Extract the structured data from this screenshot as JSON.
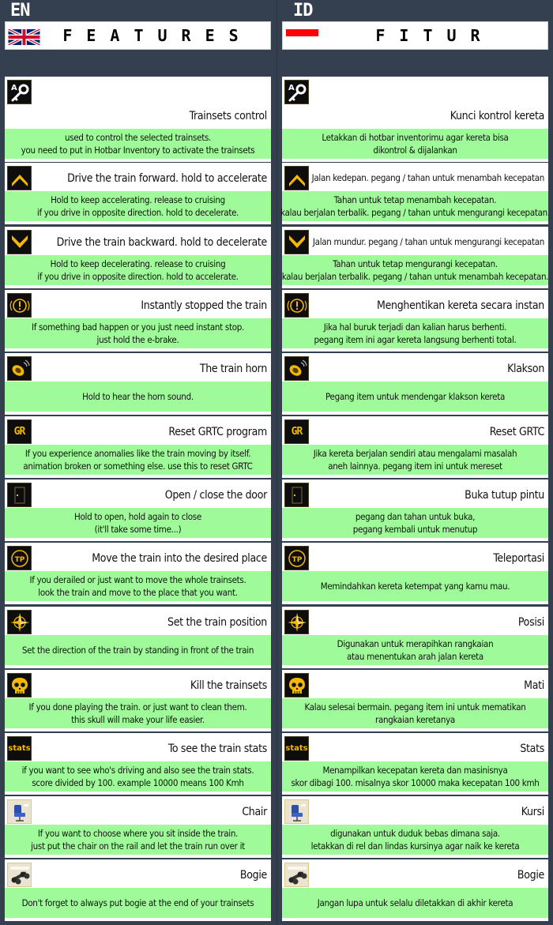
{
  "columns": [
    {
      "lang": "EN",
      "header_title": "FEATURES",
      "flag": "uk-flag",
      "items": [
        {
          "icon": "key-icon",
          "title": "Trainsets control",
          "desc": [
            "used to control the selected trainsets.",
            "you need to put in Hotbar Inventory to activate the trainsets"
          ]
        },
        {
          "icon": "chevron-up-icon",
          "title": "Drive the train forward. hold to accelerate",
          "desc": [
            "Hold to keep accelerating. release to cruising",
            "if you drive in opposite direction. hold to decelerate."
          ]
        },
        {
          "icon": "chevron-down-icon",
          "title": "Drive the train backward. hold to decelerate",
          "desc": [
            "Hold to keep decelerating. release to cruising",
            "if you drive in opposite direction. hold to accelerate."
          ]
        },
        {
          "icon": "emergency-brake-icon",
          "title": "Instantly stopped the train",
          "desc": [
            "If something bad happen or you just need instant stop.",
            "just hold the e-brake."
          ]
        },
        {
          "icon": "horn-icon",
          "title": "The train horn",
          "desc": [
            "Hold to hear the horn sound."
          ]
        },
        {
          "icon": "grtc-reset-icon",
          "title": "Reset GRTC program",
          "desc": [
            "If you experience anomalies like the train moving by itself.",
            "animation broken or something else. use this to reset GRTC"
          ]
        },
        {
          "icon": "door-icon",
          "title": "Open / close the door",
          "desc": [
            "Hold to open, hold again to close",
            "(it'll take some time...)"
          ]
        },
        {
          "icon": "teleport-icon",
          "title": "Move the train into the desired place",
          "desc": [
            "If you derailed or just want to move the whole trainsets.",
            "look the train and move to the place that you want."
          ]
        },
        {
          "icon": "compass-icon",
          "title": "Set the train position",
          "desc": [
            "Set the direction of the train by standing in front of the train"
          ]
        },
        {
          "icon": "skull-icon",
          "title": "Kill the trainsets",
          "desc": [
            "If you done playing the train. or just want to clean them.",
            "this skull will make your life easier."
          ]
        },
        {
          "icon": "stats-icon",
          "title": "To see the train stats",
          "desc": [
            "if you want to see who's driving and also see the train stats.",
            "score divided by 100. example 10000 means 100 Kmh"
          ]
        },
        {
          "icon": "chair-icon",
          "title": "Chair",
          "desc": [
            "If you want to choose where you sit inside the train.",
            "just put the chair on the rail and let the train run over it"
          ]
        },
        {
          "icon": "bogie-icon",
          "title": "Bogie",
          "desc": [
            "Don't forget to always put bogie at the end of your trainsets"
          ]
        }
      ]
    },
    {
      "lang": "ID",
      "header_title": "FITUR",
      "flag": "indonesia-flag",
      "items": [
        {
          "icon": "key-icon",
          "title": "Kunci kontrol kereta",
          "desc": [
            "Letakkan di hotbar inventorimu agar kereta bisa",
            "dikontrol & dijalankan"
          ]
        },
        {
          "icon": "chevron-up-icon",
          "title": "Jalan kedepan. pegang / tahan untuk menambah kecepatan",
          "desc": [
            "Tahan untuk tetap menambah kecepatan.",
            "kalau berjalan terbalik. pegang / tahan untuk mengurangi kecepatan."
          ]
        },
        {
          "icon": "chevron-down-icon",
          "title": "Jalan mundur. pegang / tahan untuk mengurangi kecepatan",
          "desc": [
            "Tahan untuk tetap mengurangi kecepatan.",
            "kalau berjalan terbalik. pegang / tahan untuk menambah kecepatan."
          ]
        },
        {
          "icon": "emergency-brake-icon",
          "title": "Menghentikan kereta secara instan",
          "desc": [
            "Jika hal buruk terjadi dan kalian harus berhenti.",
            "pegang item ini agar kereta langsung berhenti total."
          ]
        },
        {
          "icon": "horn-icon",
          "title": "Klakson",
          "desc": [
            "Pegang item untuk mendengar klakson kereta"
          ]
        },
        {
          "icon": "grtc-reset-icon",
          "title": "Reset GRTC",
          "desc": [
            "Jika kereta berjalan sendiri atau mengalami masalah",
            "aneh lainnya. pegang item ini untuk mereset"
          ]
        },
        {
          "icon": "door-icon",
          "title": "Buka tutup pintu",
          "desc": [
            "pegang dan tahan untuk buka,",
            "pegang kembali untuk menutup"
          ]
        },
        {
          "icon": "teleport-icon",
          "title": "Teleportasi",
          "desc": [
            "Memindahkan kereta ketempat yang kamu mau."
          ]
        },
        {
          "icon": "compass-icon",
          "title": "Posisi",
          "desc": [
            "Digunakan untuk merapihkan rangkaian",
            "atau menentukan arah jalan kereta"
          ]
        },
        {
          "icon": "skull-icon",
          "title": "Mati",
          "desc": [
            "Kalau selesai bermain. pegang item ini untuk mematikan",
            "rangkaian keretanya"
          ]
        },
        {
          "icon": "stats-icon",
          "title": "Stats",
          "desc": [
            "Menampilkan kecepatan kereta dan masinisnya",
            "skor dibagi 100. misalnya skor 10000 maka kecepatan 100 kmh"
          ]
        },
        {
          "icon": "chair-icon",
          "title": "Kursi",
          "desc": [
            "digunakan untuk duduk bebas dimana saja.",
            "letakkan di rel dan lindas kursinya agar naik ke kereta"
          ]
        },
        {
          "icon": "bogie-icon",
          "title": "Bogie",
          "desc": [
            "Jangan lupa untuk selalu diletakkan di akhir kereta"
          ]
        }
      ]
    }
  ],
  "icon_labels": {
    "grtc": "GR",
    "teleport": "TP",
    "stats": "stats",
    "key_letter": "A"
  },
  "colors": {
    "background": "#34404f",
    "card": "#ffffff",
    "description": "#9ffb99",
    "icon_gold": "#f5b800"
  }
}
